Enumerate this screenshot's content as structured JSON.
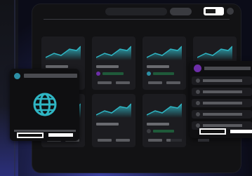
{
  "theme": {
    "accent": "#2fb6c4",
    "background": "#121214",
    "card": "#1c1c20",
    "avatar_teal": "#2d8fa5",
    "avatar_purple": "#6d2ea8",
    "avatar_dark": "#3a3b40",
    "status_green": "#1f5a3a"
  },
  "toolbar": {
    "toggle_state": "on"
  },
  "cards": [
    {
      "chart_icon": "area-chart-icon",
      "avatar_color": "none"
    },
    {
      "chart_icon": "area-chart-icon",
      "avatar_color": "#6d2ea8"
    },
    {
      "chart_icon": "area-chart-icon",
      "avatar_color": "#2d8fa5"
    },
    {
      "chart_icon": "area-chart-icon",
      "avatar_color": "none"
    },
    {
      "chart_icon": "area-chart-icon",
      "avatar_color": "none"
    },
    {
      "chart_icon": "area-chart-icon",
      "avatar_color": "#3a3b40"
    },
    {
      "chart_icon": "area-chart-icon",
      "avatar_color": "#2d8fa5"
    }
  ],
  "left_panel": {
    "icon": "globe-icon"
  },
  "right_panel": {
    "row_count": 5
  }
}
